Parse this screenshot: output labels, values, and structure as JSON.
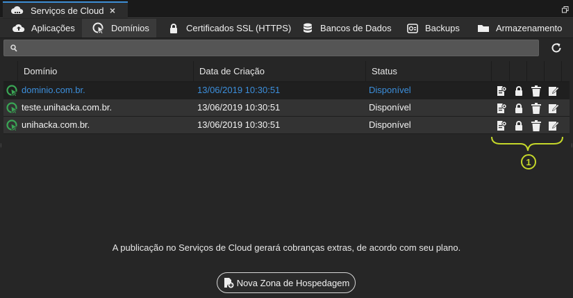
{
  "window": {
    "title": "Serviços de Cloud",
    "close_glyph": "×",
    "icon": "cloud-icon",
    "maximize_icon": "restore-icon"
  },
  "nav_tabs": [
    {
      "label": "Aplicações",
      "icon": "cloud-upload-icon",
      "active": false
    },
    {
      "label": "Domínios",
      "icon": "domain-cursor-icon",
      "active": true
    },
    {
      "label": "Certificados SSL (HTTPS)",
      "icon": "lock-icon",
      "active": false
    },
    {
      "label": "Bancos de Dados",
      "icon": "database-icon",
      "active": false
    },
    {
      "label": "Backups",
      "icon": "backup-drive-icon",
      "active": false
    },
    {
      "label": "Armazenamento",
      "icon": "folder-icon",
      "active": false
    }
  ],
  "search": {
    "value": "",
    "placeholder": ""
  },
  "table": {
    "columns": [
      "Domínio",
      "Data de Criação",
      "Status"
    ],
    "rows": [
      {
        "domain": "dominio.com.br.",
        "created": "13/06/2019 10:30:51",
        "status": "Disponível"
      },
      {
        "domain": "teste.unihacka.com.br.",
        "created": "13/06/2019 10:30:51",
        "status": "Disponível"
      },
      {
        "domain": "unihacka.com.br.",
        "created": "13/06/2019 10:30:51",
        "status": "Disponível"
      }
    ],
    "row_actions": [
      "ssl-certificate-icon",
      "lock-icon",
      "trash-icon",
      "edit-icon"
    ]
  },
  "annotation": {
    "label": "1",
    "color": "#c5d82a"
  },
  "footer": {
    "note": "A publicação no Serviços de Cloud gerará cobranças extras, de acordo com seu plano.",
    "new_zone_button": "Nova Zona de Hospedagem"
  },
  "colors": {
    "accent": "#3d8fd6",
    "link": "#3c8fdc",
    "status_green": "#3aa655",
    "background": "#262626"
  }
}
